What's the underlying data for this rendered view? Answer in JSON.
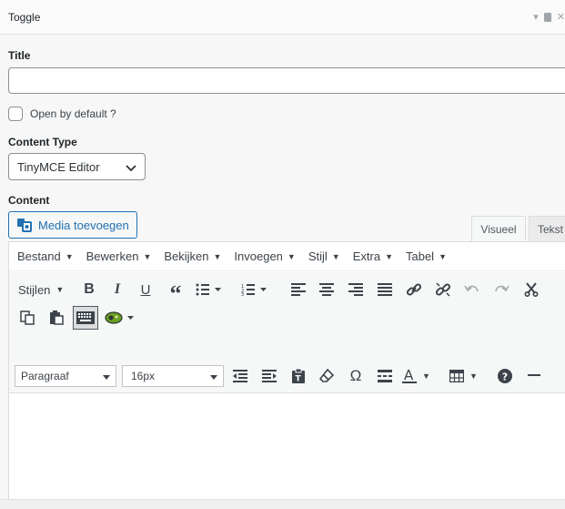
{
  "panel": {
    "title": "Toggle",
    "icons": [
      "collapse-arrow-icon",
      "duplicate-icon",
      "close-icon"
    ]
  },
  "fields": {
    "title_label": "Title",
    "title_value": "",
    "open_default_label": "Open by default ?",
    "open_default_checked": false,
    "content_type_label": "Content Type",
    "content_type_value": "TinyMCE Editor",
    "content_label": "Content"
  },
  "editor": {
    "media_button": "Media toevoegen",
    "tabs": [
      "Visueel",
      "Tekst"
    ],
    "active_tab": "Visueel",
    "menubar": [
      "Bestand",
      "Bewerken",
      "Bekijken",
      "Invoegen",
      "Stijl",
      "Extra",
      "Tabel"
    ],
    "toolbar1": [
      "styles-dropdown",
      "bold-icon",
      "italic-icon",
      "underline-icon",
      "blockquote-icon",
      "bullet-list-icon",
      "numbered-list-icon",
      "align-left-icon",
      "align-center-icon",
      "align-right-icon",
      "align-justify-icon",
      "link-icon",
      "unlink-icon",
      "undo-icon",
      "redo-icon",
      "cut-icon"
    ],
    "styles_label": "Stijlen",
    "toolbar2": [
      "copy-icon",
      "paste-icon",
      "keyboard-icon",
      "plugin-icon"
    ],
    "paragraph_value": "Paragraaf",
    "font_size_value": "16px",
    "colors": {
      "accent": "#2271b1",
      "plugin_green": "#6a9f1f"
    }
  }
}
